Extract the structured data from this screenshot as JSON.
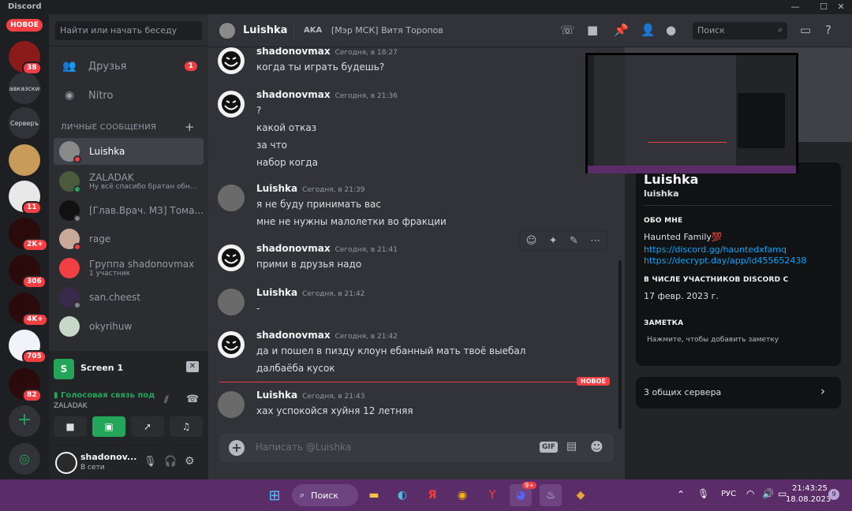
{
  "app": {
    "title": "Discord"
  },
  "rail": {
    "new_label": "НОВОЕ",
    "servers": [
      {
        "label": "",
        "badge": "38",
        "color": "#8b1a1a"
      },
      {
        "label": "кавказский",
        "badge": "",
        "color": "#313338"
      },
      {
        "label": "Серверъ",
        "badge": "",
        "color": "#313338"
      },
      {
        "label": "",
        "badge": "",
        "color": "#c89b5a"
      },
      {
        "label": "",
        "badge": "11",
        "color": "#e8e8e8"
      },
      {
        "label": "",
        "badge": "2K+",
        "color": "#2a0a0a"
      },
      {
        "label": "",
        "badge": "306",
        "color": "#2a0a0a"
      },
      {
        "label": "",
        "badge": "4K+",
        "color": "#2a0a0a"
      },
      {
        "label": "",
        "badge": "705",
        "color": "#f0f4fa"
      },
      {
        "label": "",
        "badge": "82",
        "color": "#2a0a0a"
      }
    ]
  },
  "dmlist": {
    "search_placeholder": "Найти или начать беседу",
    "friends_label": "Друзья",
    "friends_badge": "1",
    "nitro_label": "Nitro",
    "section_label": "ЛИЧНЫЕ СООБЩЕНИЯ",
    "items": [
      {
        "name": "Luishka",
        "sub": "",
        "color": "#8a8a8a",
        "status": "#f23f43"
      },
      {
        "name": "ZALADAK",
        "sub": "Ну всё спасибо братан обня...",
        "color": "#4a5a3a",
        "status": "#23a55a"
      },
      {
        "name": "[Глав.Врач. МЗ] Тома...",
        "sub": "",
        "color": "#111111",
        "status": "#80848e"
      },
      {
        "name": "rage",
        "sub": "",
        "color": "#c9a99a",
        "status": "#f23f43"
      },
      {
        "name": "Группа shadonovmax",
        "sub": "1 участник",
        "color": "#f23f43",
        "status": ""
      },
      {
        "name": "san.cheest",
        "sub": "",
        "color": "#3a2a4a",
        "status": "#80848e"
      },
      {
        "name": "okyrihuw",
        "sub": "",
        "color": "#c8d8c8",
        "status": ""
      }
    ]
  },
  "voice": {
    "stream_title": "Screen 1",
    "status": "Голосовая связь под",
    "channel": "ZALADAK"
  },
  "user": {
    "name": "shadonov...",
    "status": "В сети"
  },
  "header": {
    "name": "Luishka",
    "aka_label": "AKA",
    "aka_value": "[Мэр МСК] Витя Торопов",
    "search_placeholder": "Поиск"
  },
  "messages": [
    {
      "author": "shadonovmax",
      "time": "Сегодня, в 18:27",
      "lines": [
        "когда ты играть будешь?"
      ],
      "avatar": "troll"
    },
    {
      "author": "shadonovmax",
      "time": "Сегодня, в 21:36",
      "lines": [
        "?",
        "какой отказ",
        "за что",
        "набор когда"
      ],
      "avatar": "troll"
    },
    {
      "author": "Luishka",
      "time": "Сегодня, в 21:39",
      "lines": [
        "я не буду принимать вас",
        "мне не нужны малолетки во фракции"
      ],
      "avatar": "photo"
    },
    {
      "author": "shadonovmax",
      "time": "Сегодня, в 21:41",
      "lines": [
        "прими в друзья надо"
      ],
      "avatar": "troll"
    },
    {
      "author": "Luishka",
      "time": "Сегодня, в 21:42",
      "lines": [
        "-"
      ],
      "avatar": "photo"
    },
    {
      "author": "shadonovmax",
      "time": "Сегодня, в 21:42",
      "lines": [
        "да и пошел в пизду клоун ебанный мать твоё выебал",
        "далбаёба кусок"
      ],
      "avatar": "troll"
    },
    {
      "author": "Luishka",
      "time": "Сегодня, в 21:43",
      "lines": [
        "хах успокойся хуйня 12 летняя"
      ],
      "avatar": "photo"
    }
  ],
  "new_divider": "НОВОЕ",
  "composer": {
    "placeholder": "Написать @Luishka",
    "gif": "GIF"
  },
  "profile": {
    "display_name": "Luishka",
    "username": "luishka",
    "about_heading": "ОБО МНЕ",
    "about_text": "Haunted Family💯",
    "links": [
      "https://discord.gg/hauntedxfamq",
      "https://decrypt.day/app/id455652438"
    ],
    "member_heading": "В ЧИСЛЕ УЧАСТНИКОВ DISCORD С",
    "member_since": "17 февр. 2023 г.",
    "note_heading": "ЗАМЕТКА",
    "note_placeholder": "Нажмите, чтобы добавить заметку",
    "mutual": "3 общих сервера"
  },
  "taskbar": {
    "search_label": "Поиск",
    "discord_badge": "9+",
    "lang": "РУС",
    "time": "21:43:25",
    "date": "18.08.2023",
    "notif": "9"
  }
}
